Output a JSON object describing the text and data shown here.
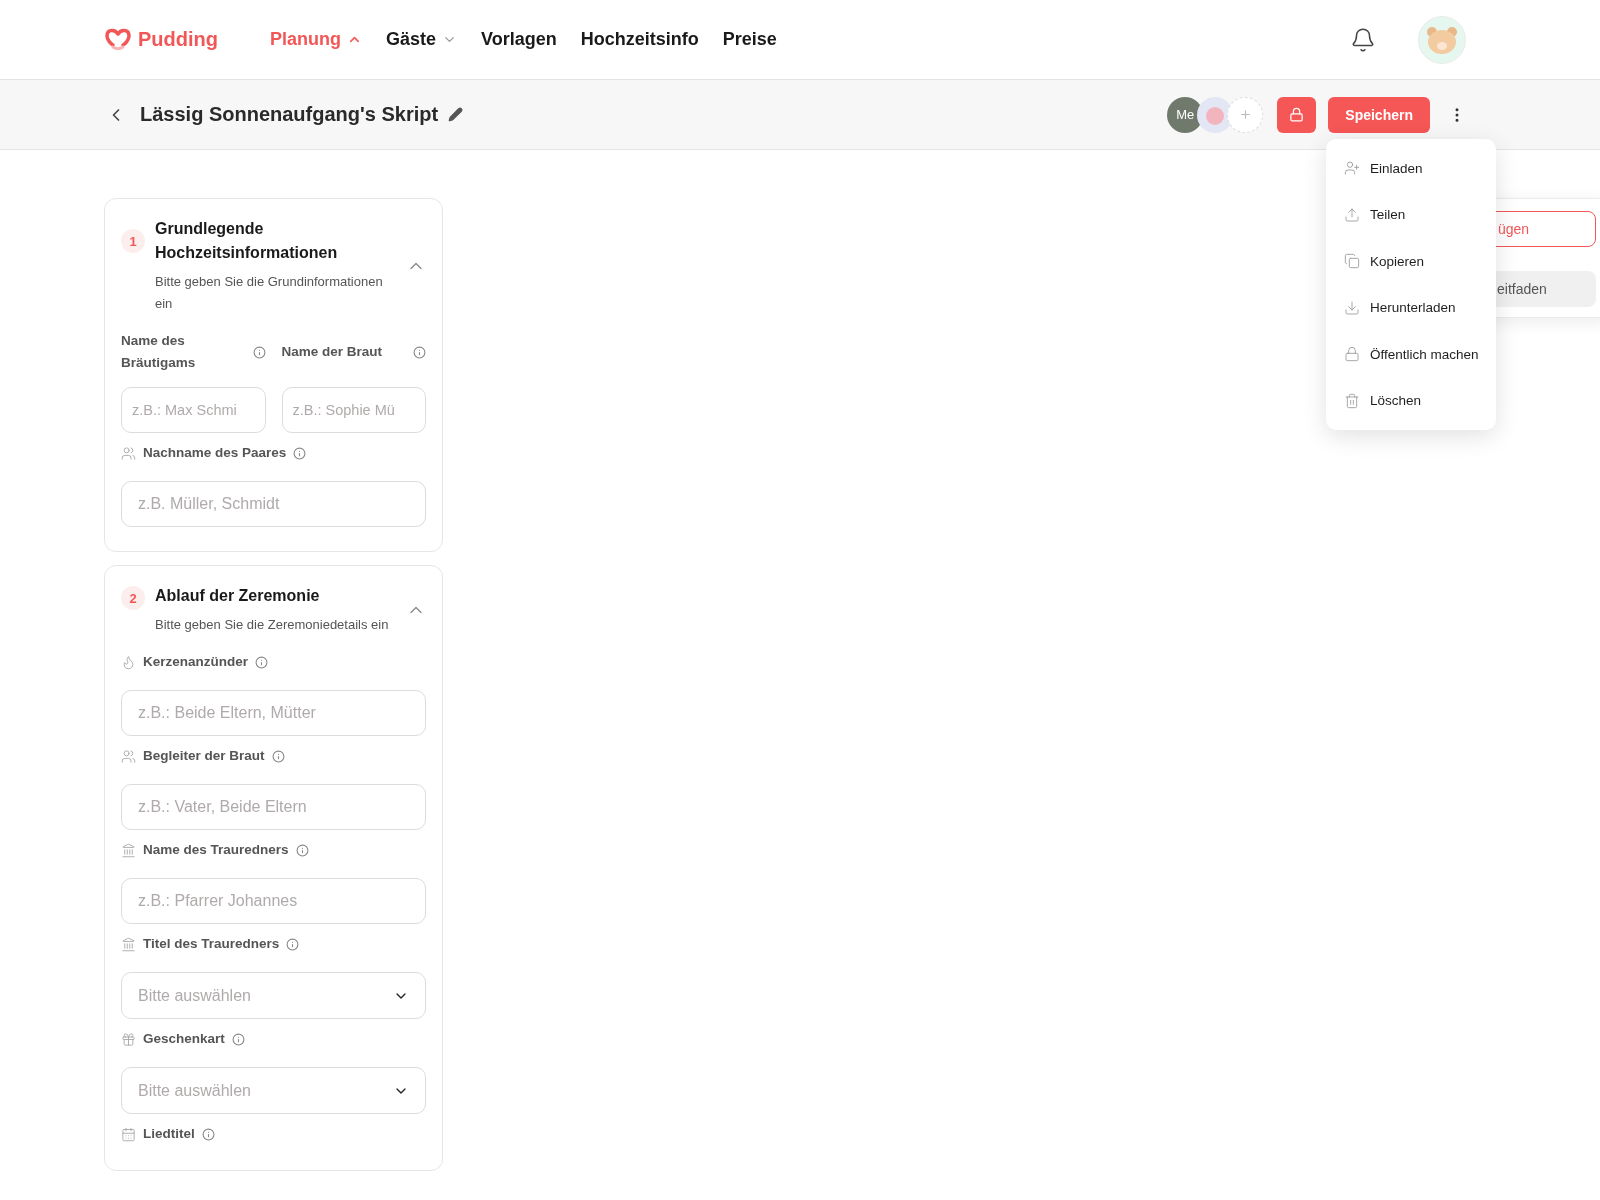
{
  "brand": {
    "name": "Pudding"
  },
  "nav": [
    {
      "label": "Planung",
      "kind": "menu",
      "selected": true,
      "expanded": true
    },
    {
      "label": "Gäste",
      "kind": "menu",
      "selected": false,
      "expanded": false
    },
    {
      "label": "Vorlagen",
      "kind": "link",
      "selected": false
    },
    {
      "label": "Hochzeitsinfo",
      "kind": "link",
      "selected": false
    },
    {
      "label": "Preise",
      "kind": "link",
      "selected": false
    }
  ],
  "toolbar": {
    "title": "Lässig Sonnenaufgang's Skript",
    "collaborators": [
      {
        "kind": "initials",
        "label": "Me"
      },
      {
        "kind": "picture"
      }
    ],
    "save_label": "Speichern",
    "locked": true
  },
  "actions_menu": [
    {
      "label": "Einladen"
    },
    {
      "label": "Teilen"
    },
    {
      "label": "Kopieren"
    },
    {
      "label": "Herunterladen"
    },
    {
      "label": "Öffentlich machen"
    },
    {
      "label": "Löschen"
    }
  ],
  "side_panel": {
    "buttons": [
      {
        "kind": "outline",
        "label": "ügen"
      },
      {
        "kind": "secondary",
        "label": "eitfaden"
      }
    ]
  },
  "sections": [
    {
      "number": "1",
      "title": "Grundlegende Hochzeitsinformationen",
      "subtitle": "Bitte geben Sie die Grundinformationen ein",
      "expanded": true,
      "fields": [
        {
          "kind": "half",
          "label": "Name des Bräutigams",
          "placeholder": "z.B.: Max Schmi"
        },
        {
          "kind": "half",
          "label": "Name der Braut",
          "placeholder": "z.B.: Sophie Mü"
        },
        {
          "kind": "text",
          "label": "Nachname des Paares",
          "placeholder": "z.B. Müller, Schmidt"
        }
      ]
    },
    {
      "number": "2",
      "title": "Ablauf der Zeremonie",
      "subtitle": "Bitte geben Sie die Zeremoniedetails ein",
      "expanded": true,
      "fields": [
        {
          "kind": "text",
          "label": "Kerzenanzünder",
          "placeholder": "z.B.: Beide Eltern, Mütter"
        },
        {
          "kind": "text",
          "label": "Begleiter der Braut",
          "placeholder": "z.B.: Vater, Beide Eltern"
        },
        {
          "kind": "text",
          "label": "Name des Trauredners",
          "placeholder": "z.B.: Pfarrer Johannes"
        },
        {
          "kind": "select",
          "label": "Titel des Trauredners",
          "placeholder": "Bitte auswählen"
        },
        {
          "kind": "select",
          "label": "Geschenkart",
          "placeholder": "Bitte auswählen"
        },
        {
          "kind": "label",
          "label": "Liedtitel"
        }
      ]
    }
  ]
}
